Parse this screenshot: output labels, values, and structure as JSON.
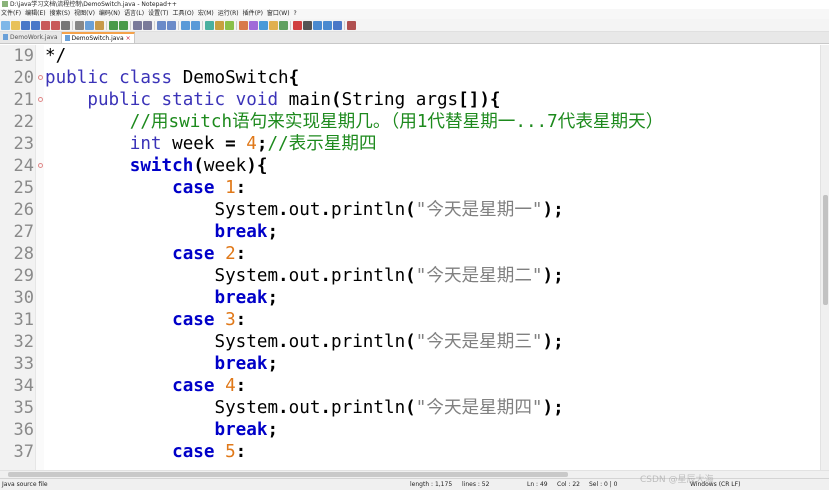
{
  "window": {
    "title": "D:\\java学习文档\\流程控制\\DemoSwitch.java - Notepad++"
  },
  "menu": [
    "文件(F)",
    "编辑(E)",
    "搜索(S)",
    "视图(V)",
    "编码(N)",
    "语言(L)",
    "设置(T)",
    "工具(O)",
    "宏(M)",
    "运行(R)",
    "插件(P)",
    "窗口(W)",
    "?"
  ],
  "tabs": [
    {
      "label": "DemoWork.java",
      "active": false
    },
    {
      "label": "DemoSwitch.java",
      "active": true
    }
  ],
  "editor": {
    "lines": [
      {
        "n": "19",
        "fold": false,
        "tokens": [
          {
            "t": "*/",
            "c": ""
          }
        ]
      },
      {
        "n": "20",
        "fold": true,
        "tokens": [
          {
            "t": "public class",
            "c": "kw"
          },
          {
            "t": " DemoSwitch",
            "c": ""
          },
          {
            "t": "{",
            "c": "op"
          }
        ]
      },
      {
        "n": "21",
        "fold": true,
        "tokens": [
          {
            "t": "    ",
            "c": ""
          },
          {
            "t": "public static void",
            "c": "kw"
          },
          {
            "t": " main",
            "c": ""
          },
          {
            "t": "(",
            "c": "op"
          },
          {
            "t": "String args",
            "c": ""
          },
          {
            "t": "[]){",
            "c": "op"
          }
        ]
      },
      {
        "n": "22",
        "fold": false,
        "tokens": [
          {
            "t": "        ",
            "c": ""
          },
          {
            "t": "//用switch语句来实现星期几。（用1代替星期一...7代表星期天）",
            "c": "cmt"
          }
        ]
      },
      {
        "n": "23",
        "fold": false,
        "tokens": [
          {
            "t": "        ",
            "c": ""
          },
          {
            "t": "int",
            "c": "kw"
          },
          {
            "t": " week ",
            "c": ""
          },
          {
            "t": "=",
            "c": "op"
          },
          {
            "t": " ",
            "c": ""
          },
          {
            "t": "4",
            "c": "num"
          },
          {
            "t": ";",
            "c": "op"
          },
          {
            "t": "//表示星期四",
            "c": "cmt"
          }
        ]
      },
      {
        "n": "24",
        "fold": true,
        "tokens": [
          {
            "t": "        ",
            "c": ""
          },
          {
            "t": "switch",
            "c": "kwb"
          },
          {
            "t": "(",
            "c": "op"
          },
          {
            "t": "week",
            "c": ""
          },
          {
            "t": "){",
            "c": "op"
          }
        ]
      },
      {
        "n": "25",
        "fold": false,
        "tokens": [
          {
            "t": "            ",
            "c": ""
          },
          {
            "t": "case",
            "c": "kwb"
          },
          {
            "t": " ",
            "c": ""
          },
          {
            "t": "1",
            "c": "num"
          },
          {
            "t": ":",
            "c": "op"
          }
        ]
      },
      {
        "n": "26",
        "fold": false,
        "tokens": [
          {
            "t": "                System",
            "c": ""
          },
          {
            "t": ".",
            "c": "op"
          },
          {
            "t": "out",
            "c": ""
          },
          {
            "t": ".",
            "c": "op"
          },
          {
            "t": "println",
            "c": ""
          },
          {
            "t": "(",
            "c": "op"
          },
          {
            "t": "\"今天是星期一\"",
            "c": "str"
          },
          {
            "t": ");",
            "c": "op"
          }
        ]
      },
      {
        "n": "27",
        "fold": false,
        "tokens": [
          {
            "t": "                ",
            "c": ""
          },
          {
            "t": "break",
            "c": "kwb"
          },
          {
            "t": ";",
            "c": "op"
          }
        ]
      },
      {
        "n": "28",
        "fold": false,
        "tokens": [
          {
            "t": "            ",
            "c": ""
          },
          {
            "t": "case",
            "c": "kwb"
          },
          {
            "t": " ",
            "c": ""
          },
          {
            "t": "2",
            "c": "num"
          },
          {
            "t": ":",
            "c": "op"
          }
        ]
      },
      {
        "n": "29",
        "fold": false,
        "tokens": [
          {
            "t": "                System",
            "c": ""
          },
          {
            "t": ".",
            "c": "op"
          },
          {
            "t": "out",
            "c": ""
          },
          {
            "t": ".",
            "c": "op"
          },
          {
            "t": "println",
            "c": ""
          },
          {
            "t": "(",
            "c": "op"
          },
          {
            "t": "\"今天是星期二\"",
            "c": "str"
          },
          {
            "t": ");",
            "c": "op"
          }
        ]
      },
      {
        "n": "30",
        "fold": false,
        "tokens": [
          {
            "t": "                ",
            "c": ""
          },
          {
            "t": "break",
            "c": "kwb"
          },
          {
            "t": ";",
            "c": "op"
          }
        ]
      },
      {
        "n": "31",
        "fold": false,
        "tokens": [
          {
            "t": "            ",
            "c": ""
          },
          {
            "t": "case",
            "c": "kwb"
          },
          {
            "t": " ",
            "c": ""
          },
          {
            "t": "3",
            "c": "num"
          },
          {
            "t": ":",
            "c": "op"
          }
        ]
      },
      {
        "n": "32",
        "fold": false,
        "tokens": [
          {
            "t": "                System",
            "c": ""
          },
          {
            "t": ".",
            "c": "op"
          },
          {
            "t": "out",
            "c": ""
          },
          {
            "t": ".",
            "c": "op"
          },
          {
            "t": "println",
            "c": ""
          },
          {
            "t": "(",
            "c": "op"
          },
          {
            "t": "\"今天是星期三\"",
            "c": "str"
          },
          {
            "t": ");",
            "c": "op"
          }
        ]
      },
      {
        "n": "33",
        "fold": false,
        "tokens": [
          {
            "t": "                ",
            "c": ""
          },
          {
            "t": "break",
            "c": "kwb"
          },
          {
            "t": ";",
            "c": "op"
          }
        ]
      },
      {
        "n": "34",
        "fold": false,
        "tokens": [
          {
            "t": "            ",
            "c": ""
          },
          {
            "t": "case",
            "c": "kwb"
          },
          {
            "t": " ",
            "c": ""
          },
          {
            "t": "4",
            "c": "num"
          },
          {
            "t": ":",
            "c": "op"
          }
        ]
      },
      {
        "n": "35",
        "fold": false,
        "tokens": [
          {
            "t": "                System",
            "c": ""
          },
          {
            "t": ".",
            "c": "op"
          },
          {
            "t": "out",
            "c": ""
          },
          {
            "t": ".",
            "c": "op"
          },
          {
            "t": "println",
            "c": ""
          },
          {
            "t": "(",
            "c": "op"
          },
          {
            "t": "\"今天是星期四\"",
            "c": "str"
          },
          {
            "t": ");",
            "c": "op"
          }
        ]
      },
      {
        "n": "36",
        "fold": false,
        "tokens": [
          {
            "t": "                ",
            "c": ""
          },
          {
            "t": "break",
            "c": "kwb"
          },
          {
            "t": ";",
            "c": "op"
          }
        ]
      },
      {
        "n": "37",
        "fold": false,
        "tokens": [
          {
            "t": "            ",
            "c": ""
          },
          {
            "t": "case",
            "c": "kwb"
          },
          {
            "t": " ",
            "c": ""
          },
          {
            "t": "5",
            "c": "num"
          },
          {
            "t": ":",
            "c": "op"
          }
        ]
      }
    ]
  },
  "statusbar": {
    "filetype": "Java source file",
    "length": "length : 1,175",
    "lines": "lines : 52",
    "ln": "Ln : 49",
    "col": "Col : 22",
    "sel": "Sel : 0 | 0",
    "eol": "Windows (CR LF)"
  },
  "watermark": "CSDN @星辰大海"
}
